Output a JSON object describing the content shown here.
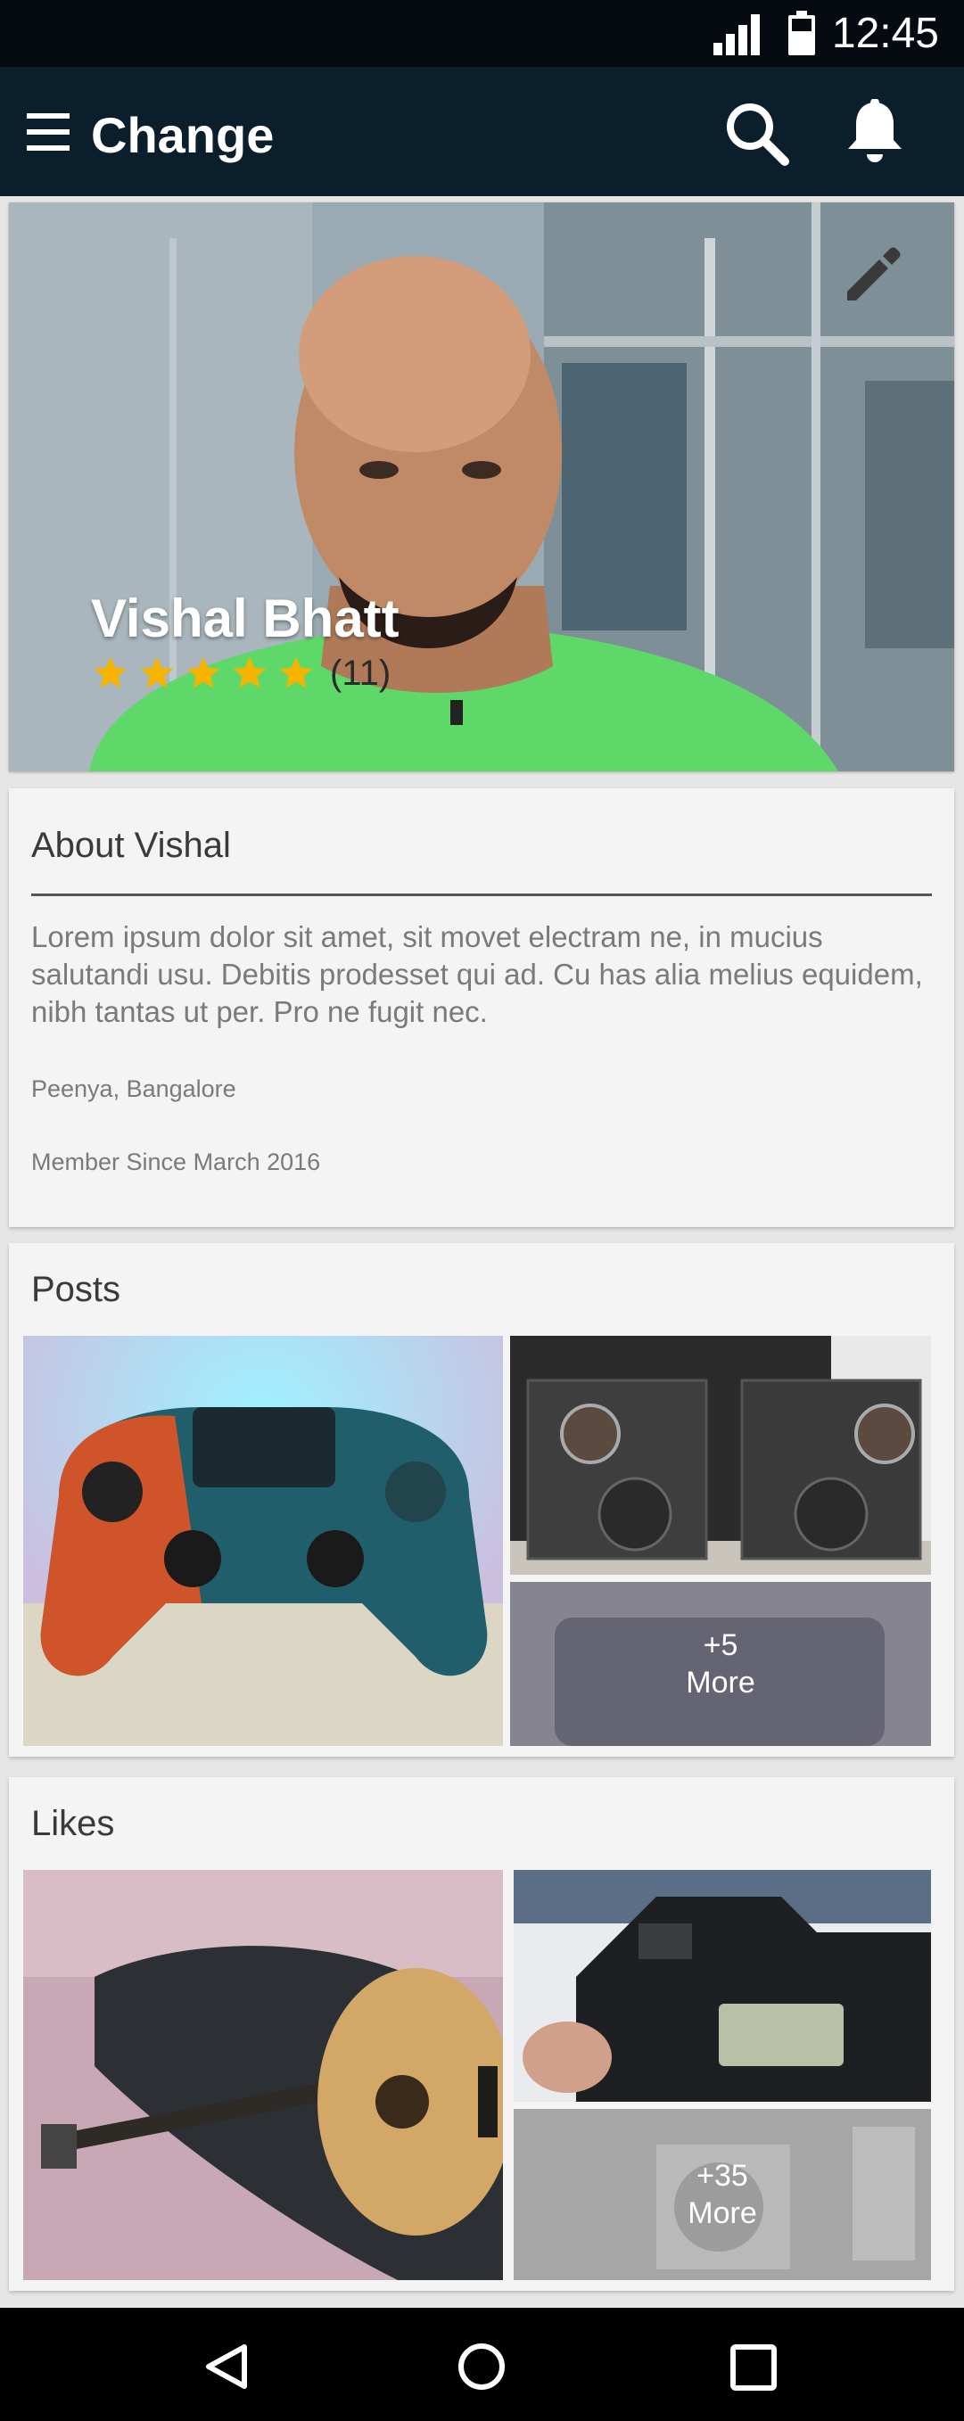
{
  "status": {
    "time": "12:45",
    "signal_icon": "signal-icon",
    "battery_icon": "battery-icon"
  },
  "appbar": {
    "title": "Change",
    "menu_icon": "menu-icon",
    "search_icon": "search-icon",
    "notification_icon": "bell-icon"
  },
  "profile": {
    "name": "Vishal Bhatt",
    "rating": 5,
    "rating_count": "(11)",
    "edit_icon": "pencil-icon",
    "star_color": "#f5b400"
  },
  "about": {
    "title": "About Vishal",
    "text": "Lorem ipsum dolor sit amet, sit movet electram ne, in mucius salutandi usu. Debitis prodesset qui ad. Cu has alia melius equidem, nibh tantas ut per. Pro ne fugit nec.",
    "location": "Peenya, Bangalore",
    "member_since": "Member Since March 2016"
  },
  "posts": {
    "title": "Posts",
    "more_count": "+5",
    "more_label": "More"
  },
  "likes": {
    "title": "Likes",
    "more_count": "+35",
    "more_label": "More"
  },
  "navbar": {
    "back_icon": "back-triangle-icon",
    "home_icon": "home-circle-icon",
    "recent_icon": "recent-square-icon"
  },
  "colors": {
    "appbar": "#0b1e2c",
    "statusbar": "#050b10",
    "card": "#f4f4f4"
  }
}
